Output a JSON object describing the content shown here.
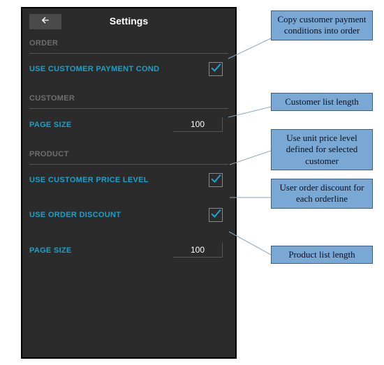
{
  "header": {
    "title": "Settings",
    "back_icon": "arrow-left"
  },
  "sections": {
    "order": {
      "heading": "ORDER",
      "use_customer_payment_cond": {
        "label": "USE CUSTOMER PAYMENT COND",
        "checked": true
      }
    },
    "customer": {
      "heading": "CUSTOMER",
      "page_size": {
        "label": "PAGE SIZE",
        "value": "100"
      }
    },
    "product": {
      "heading": "PRODUCT",
      "use_customer_price_level": {
        "label": "USE CUSTOMER PRICE LEVEL",
        "checked": true
      },
      "use_order_discount": {
        "label": "USE ORDER DISCOUNT",
        "checked": true
      },
      "page_size": {
        "label": "PAGE SIZE",
        "value": "100"
      }
    }
  },
  "annotations": {
    "a1": "Copy customer payment conditions into order",
    "a2": "Customer list length",
    "a3": "Use unit price level defined for selected customer",
    "a4": "User order discount for each orderline",
    "a5": "Product list length"
  }
}
